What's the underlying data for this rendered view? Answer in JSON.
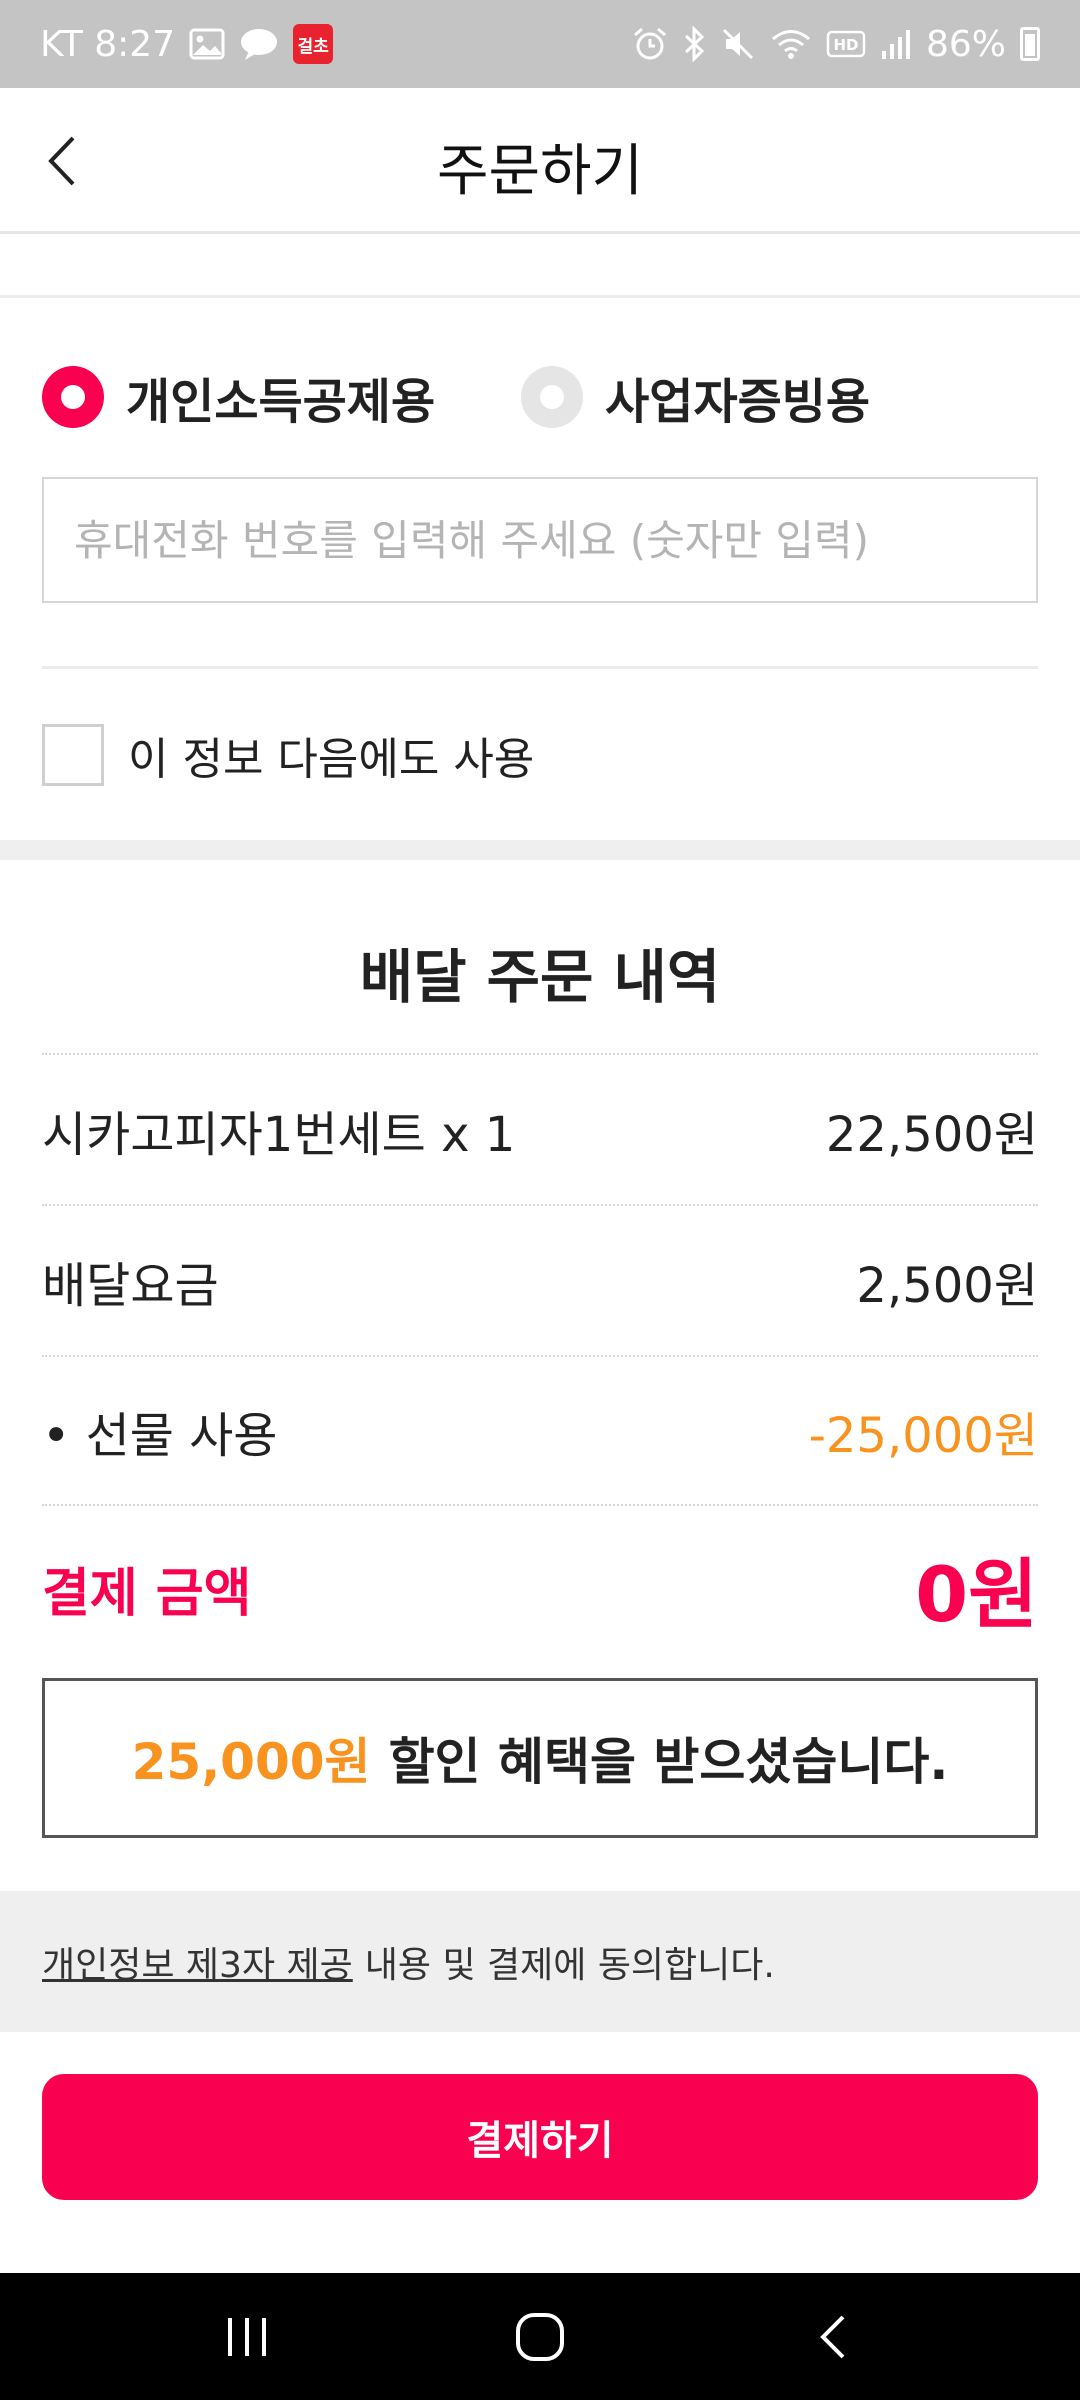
{
  "status_bar": {
    "carrier_time": "KT 8:27",
    "app_badge": "걸초",
    "battery": "86%",
    "icons": [
      "image-icon",
      "chat-bubble-icon",
      "app-badge-icon",
      "alarm-icon",
      "bluetooth-icon",
      "mute-icon",
      "wifi-icon",
      "hd-icon",
      "signal-icon",
      "battery-icon"
    ]
  },
  "header": {
    "title": "주문하기",
    "back_icon": "chevron-left-icon"
  },
  "receipt": {
    "options": [
      {
        "label": "개인소득공제용",
        "selected": true
      },
      {
        "label": "사업자증빙용",
        "selected": false
      }
    ],
    "phone_placeholder": "휴대전화 번호를 입력해 주세요 (숫자만 입력)",
    "phone_value": "",
    "remember_label": "이 정보 다음에도 사용",
    "remember_checked": false
  },
  "summary": {
    "title": "배달 주문 내역",
    "rows": [
      {
        "label": "시카고피자1번세트 x 1",
        "amount": "22,500원"
      },
      {
        "label": "배달요금",
        "amount": "2,500원"
      },
      {
        "label": "• 선물 사용",
        "amount": "-25,000원"
      }
    ],
    "total_label": "결제 금액",
    "total_amount": "0원",
    "benefit_amount": "25,000원",
    "benefit_text": "할인 혜택을 받으셨습니다."
  },
  "agreement": {
    "link_text": "개인정보 제3자 제공",
    "text": "내용 및 결제에 동의합니다."
  },
  "pay_button_label": "결제하기",
  "colors": {
    "accent": "#fa0050",
    "discount": "#f7931e",
    "status_bar_bg": "#c4c4c4",
    "nav_bar_bg": "#000000"
  },
  "nav_bar": {
    "icons": [
      "recent-apps-icon",
      "home-icon",
      "back-icon"
    ]
  }
}
